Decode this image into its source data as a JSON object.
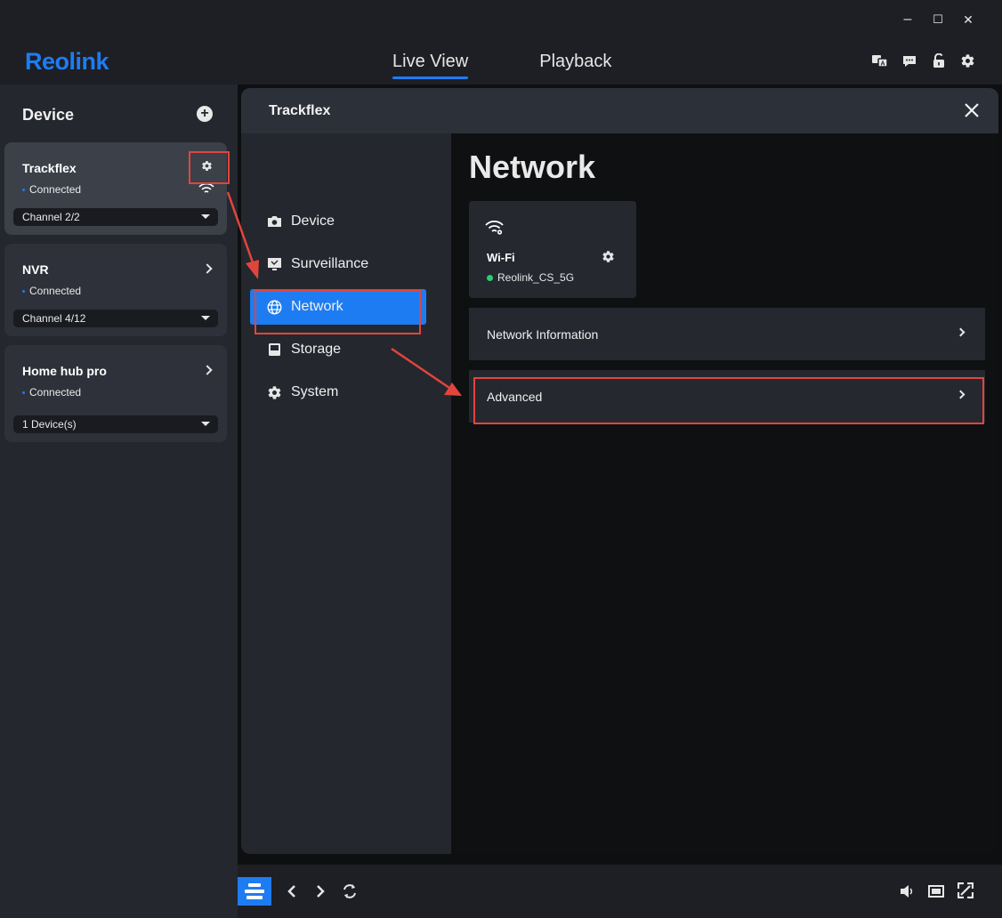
{
  "app": {
    "logo": "Reolink",
    "window_controls": {
      "minimize": "–",
      "maximize": "☐",
      "close": "✕"
    },
    "tabs": [
      {
        "label": "Live View",
        "active": true
      },
      {
        "label": "Playback",
        "active": false
      }
    ],
    "header_icons": [
      "translate-icon",
      "message-icon",
      "lock-icon",
      "gear-icon"
    ],
    "accent_color": "#1e7cf2",
    "highlight_color": "#e2453c"
  },
  "sidebar": {
    "title": "Device",
    "devices": [
      {
        "name": "Trackflex",
        "status": "Connected",
        "channel": "Channel 2/2"
      },
      {
        "name": "NVR",
        "status": "Connected",
        "channel": "Channel 4/12"
      },
      {
        "name": "Home hub pro",
        "status": "Connected",
        "channel": "1 Device(s)"
      }
    ]
  },
  "modal": {
    "title": "Trackflex",
    "nav": [
      {
        "label": "Device",
        "icon": "camera-icon"
      },
      {
        "label": "Surveillance",
        "icon": "monitor-icon"
      },
      {
        "label": "Network",
        "icon": "globe-icon",
        "active": true
      },
      {
        "label": "Storage",
        "icon": "storage-icon"
      },
      {
        "label": "System",
        "icon": "gear-icon"
      }
    ],
    "content": {
      "title": "Network",
      "wifi": {
        "label": "Wi-Fi",
        "ssid": "Reolink_CS_5G"
      },
      "rows": [
        "Network Information",
        "Advanced"
      ]
    }
  }
}
